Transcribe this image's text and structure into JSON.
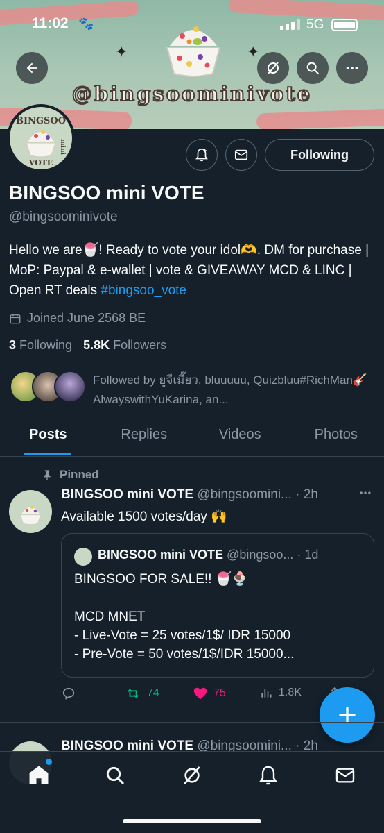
{
  "status_bar": {
    "time": "11:02",
    "network": "5G"
  },
  "banner": {
    "handle_art": "@bingsoominivote"
  },
  "avatar_text": {
    "top": "BINGSOO",
    "side": "mini",
    "bottom": "VOTE"
  },
  "profile": {
    "following_button": "Following",
    "name": "BINGSOO mini VOTE",
    "handle": "@bingsoominivote",
    "bio_part1": "Hello we are🍧! Ready to vote your idol🫶. DM for purchase | MoP: Paypal & e-wallet | vote & GIVEAWAY MCD & LINC | Open RT deals ",
    "bio_hashtag": "#bingsoo_vote",
    "joined": "Joined June 2568 BE",
    "following_count": "3",
    "following_label": "Following",
    "followers_count": "5.8K",
    "followers_label": "Followers",
    "followed_by": "Followed by ยูจีเมี๊ยว, bluuuuu, Quizbluu#RichMan🎸 AlwayswithYuKarina, an..."
  },
  "tabs": [
    {
      "label": "Posts"
    },
    {
      "label": "Replies"
    },
    {
      "label": "Videos"
    },
    {
      "label": "Photos"
    }
  ],
  "pinned_post": {
    "pinned_label": "Pinned",
    "author": "BINGSOO mini VOTE",
    "meta": "@bingsoomini... · 2h",
    "text": "Available 1500 votes/day 🙌",
    "quote": {
      "author": "BINGSOO mini VOTE",
      "meta": "@bingsoo... · 1d",
      "line1": "BINGSOO FOR SALE!! 🍧🍨",
      "line2": "MCD MNET",
      "line3": "- Live-Vote = 25 votes/1$/ IDR 15000",
      "line4": "- Pre-Vote = 50 votes/1$/IDR 15000..."
    },
    "retweets": "74",
    "likes": "75",
    "views": "1.8K"
  },
  "second_post": {
    "author": "BINGSOO mini VOTE",
    "meta": "@bingsoomini... · 2h"
  },
  "colors": {
    "accent": "#1d9bf0",
    "background": "#15202b",
    "retweet": "#00ba7c",
    "like": "#f91880"
  }
}
